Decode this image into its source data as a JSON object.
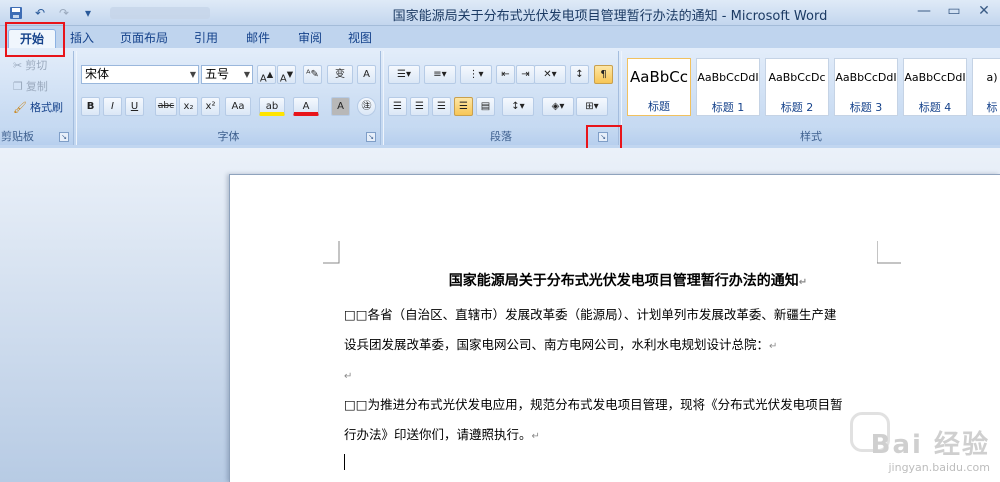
{
  "window": {
    "title": "国家能源局关于分布式光伏发电项目管理暂行办法的通知 - Microsoft Word",
    "controls": [
      "—",
      "▭",
      "✕"
    ]
  },
  "qat": {
    "save_icon": "save-icon",
    "undo_icon": "undo-icon",
    "redo_icon": "redo-icon",
    "customize": "▾"
  },
  "tabs": [
    "开始",
    "插入",
    "页面布局",
    "引用",
    "邮件",
    "审阅",
    "视图"
  ],
  "clipboard": {
    "cut": "剪切",
    "copy": "复制",
    "painter": "格式刷",
    "label": "剪贴板"
  },
  "font": {
    "name": "宋体",
    "size": "五号",
    "label": "字体",
    "buttons": [
      "B",
      "I",
      "U",
      "abc",
      "x₂",
      "x²",
      "Aa",
      "ab",
      "A",
      "A",
      "㊟"
    ]
  },
  "paragraph": {
    "label": "段落"
  },
  "styles": {
    "label": "样式",
    "items": [
      {
        "sample": "AaBbCc",
        "name": "标题"
      },
      {
        "sample": "AaBbCcDdI",
        "name": "标题 1"
      },
      {
        "sample": "AaBbCcDc",
        "name": "标题 2"
      },
      {
        "sample": "AaBbCcDdI",
        "name": "标题 3"
      },
      {
        "sample": "AaBbCcDdI",
        "name": "标题 4"
      },
      {
        "sample": "a)",
        "name": "标"
      }
    ]
  },
  "document": {
    "heading": "国家能源局关于分布式光伏发电项目管理暂行办法的通知",
    "lines": [
      "□□各省（自治区、直辖市）发展改革委（能源局）、计划单列市发展改革委、新疆生产建",
      "设兵团发展改革委，国家电网公司、南方电网公司，水利水电规划设计总院：",
      "",
      "□□为推进分布式光伏发电应用，规范分布式发电项目管理，现将《分布式光伏发电项目暂",
      "行办法》印送你们，请遵照执行。"
    ],
    "para_mark": "↵"
  },
  "watermark": {
    "brand": "Bai 经验",
    "url": "jingyan.baidu.com"
  },
  "colors": {
    "highlight": "#e8141a",
    "accent": "#15428b"
  }
}
